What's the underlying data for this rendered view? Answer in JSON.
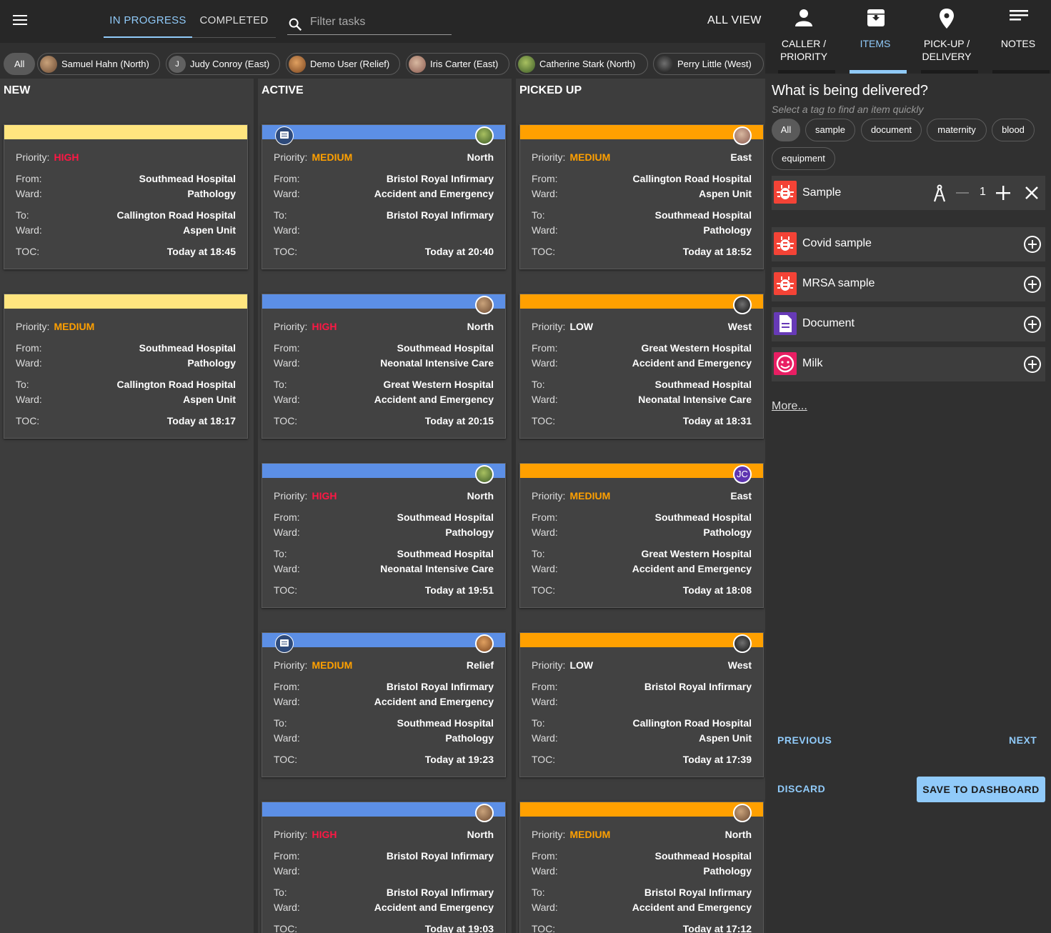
{
  "topbar": {
    "tabs": {
      "in_progress": "IN PROGRESS",
      "completed": "COMPLETED"
    },
    "search_placeholder": "Filter tasks",
    "all_view": "ALL VIEW"
  },
  "chips": {
    "all": "All",
    "users": [
      {
        "label": "Samuel Hahn (North)",
        "initial": ""
      },
      {
        "label": "Judy Conroy (East)",
        "initial": "J"
      },
      {
        "label": "Demo User (Relief)",
        "initial": ""
      },
      {
        "label": "Iris Carter (East)",
        "initial": ""
      },
      {
        "label": "Catherine Stark (North)",
        "initial": ""
      },
      {
        "label": "Perry Little (West)",
        "initial": ""
      }
    ]
  },
  "labels": {
    "priority": "Priority:",
    "from": "From:",
    "to": "To:",
    "ward": "Ward:",
    "toc": "TOC:"
  },
  "columns": {
    "new": {
      "title": "NEW",
      "cards": [
        {
          "priority": "HIGH",
          "region": "",
          "from": "Southmead Hospital",
          "from_ward": "Pathology",
          "to": "Callington Road Hospital",
          "to_ward": "Aspen Unit",
          "toc": "Today at 18:45"
        },
        {
          "priority": "MEDIUM",
          "region": "",
          "from": "Southmead Hospital",
          "from_ward": "Pathology",
          "to": "Callington Road Hospital",
          "to_ward": "Aspen Unit",
          "toc": "Today at 18:17"
        }
      ]
    },
    "active": {
      "title": "ACTIVE",
      "cards": [
        {
          "priority": "MEDIUM",
          "region": "North",
          "from": "Bristol Royal Infirmary",
          "from_ward": "Accident and Emergency",
          "to": "Bristol Royal Infirmary",
          "to_ward": "",
          "toc": "Today at 20:40"
        },
        {
          "priority": "HIGH",
          "region": "North",
          "from": "Southmead Hospital",
          "from_ward": "Neonatal Intensive Care",
          "to": "Great Western Hospital",
          "to_ward": "Accident and Emergency",
          "toc": "Today at 20:15"
        },
        {
          "priority": "HIGH",
          "region": "North",
          "from": "Southmead Hospital",
          "from_ward": "Pathology",
          "to": "Southmead Hospital",
          "to_ward": "Neonatal Intensive Care",
          "toc": "Today at 19:51"
        },
        {
          "priority": "MEDIUM",
          "region": "Relief",
          "from": "Bristol Royal Infirmary",
          "from_ward": "Accident and Emergency",
          "to": "Southmead Hospital",
          "to_ward": "Pathology",
          "toc": "Today at 19:23"
        },
        {
          "priority": "HIGH",
          "region": "North",
          "from": "Bristol Royal Infirmary",
          "from_ward": "",
          "to": "Bristol Royal Infirmary",
          "to_ward": "Accident and Emergency",
          "toc": "Today at 19:03"
        }
      ]
    },
    "picked_up": {
      "title": "PICKED UP",
      "cards": [
        {
          "priority": "MEDIUM",
          "region": "East",
          "from": "Callington Road Hospital",
          "from_ward": "Aspen Unit",
          "to": "Southmead Hospital",
          "to_ward": "Pathology",
          "toc": "Today at 18:52"
        },
        {
          "priority": "LOW",
          "region": "West",
          "from": "Great Western Hospital",
          "from_ward": "Accident and Emergency",
          "to": "Southmead Hospital",
          "to_ward": "Neonatal Intensive Care",
          "toc": "Today at 18:31"
        },
        {
          "priority": "MEDIUM",
          "region": "East",
          "from": "Southmead Hospital",
          "from_ward": "Pathology",
          "to": "Great Western Hospital",
          "to_ward": "Accident and Emergency",
          "toc": "Today at 18:08"
        },
        {
          "priority": "LOW",
          "region": "West",
          "from": "Bristol Royal Infirmary",
          "from_ward": "",
          "to": "Callington Road Hospital",
          "to_ward": "Aspen Unit",
          "toc": "Today at 17:39"
        },
        {
          "priority": "MEDIUM",
          "region": "North",
          "from": "Southmead Hospital",
          "from_ward": "Pathology",
          "to": "Bristol Royal Infirmary",
          "to_ward": "Accident and Emergency",
          "toc": "Today at 17:12"
        }
      ]
    }
  },
  "avatar_initials": "JC",
  "colors": {
    "new_stripe": "#ffe57f",
    "active_stripe": "#5c8fe6",
    "picked_stripe": "#ffa000",
    "high": "#ff1744",
    "medium": "#ffa000",
    "low": "#ffffff",
    "accent": "#90caf9"
  },
  "panel": {
    "tabs": [
      {
        "label_1": "CALLER /",
        "label_2": "PRIORITY",
        "icon": "person-icon"
      },
      {
        "label_1": "ITEMS",
        "label_2": "",
        "icon": "archive-icon"
      },
      {
        "label_1": "PICK-UP /",
        "label_2": "DELIVERY",
        "icon": "location-pin-icon"
      },
      {
        "label_1": "NOTES",
        "label_2": "",
        "icon": "notes-icon"
      }
    ],
    "question": "What is being delivered?",
    "hint": "Select a tag to find an item quickly",
    "tags": [
      "All",
      "sample",
      "document",
      "maternity",
      "blood",
      "equipment"
    ],
    "selected_item": {
      "name": "Sample",
      "quantity": "1"
    },
    "items": [
      {
        "name": "Covid sample",
        "icon": "bug-icon"
      },
      {
        "name": "MRSA sample",
        "icon": "bug-icon"
      },
      {
        "name": "Document",
        "icon": "document-icon"
      },
      {
        "name": "Milk",
        "icon": "face-icon"
      }
    ],
    "more": "More...",
    "previous": "PREVIOUS",
    "next": "NEXT",
    "discard": "DISCARD",
    "save": "SAVE TO DASHBOARD"
  }
}
